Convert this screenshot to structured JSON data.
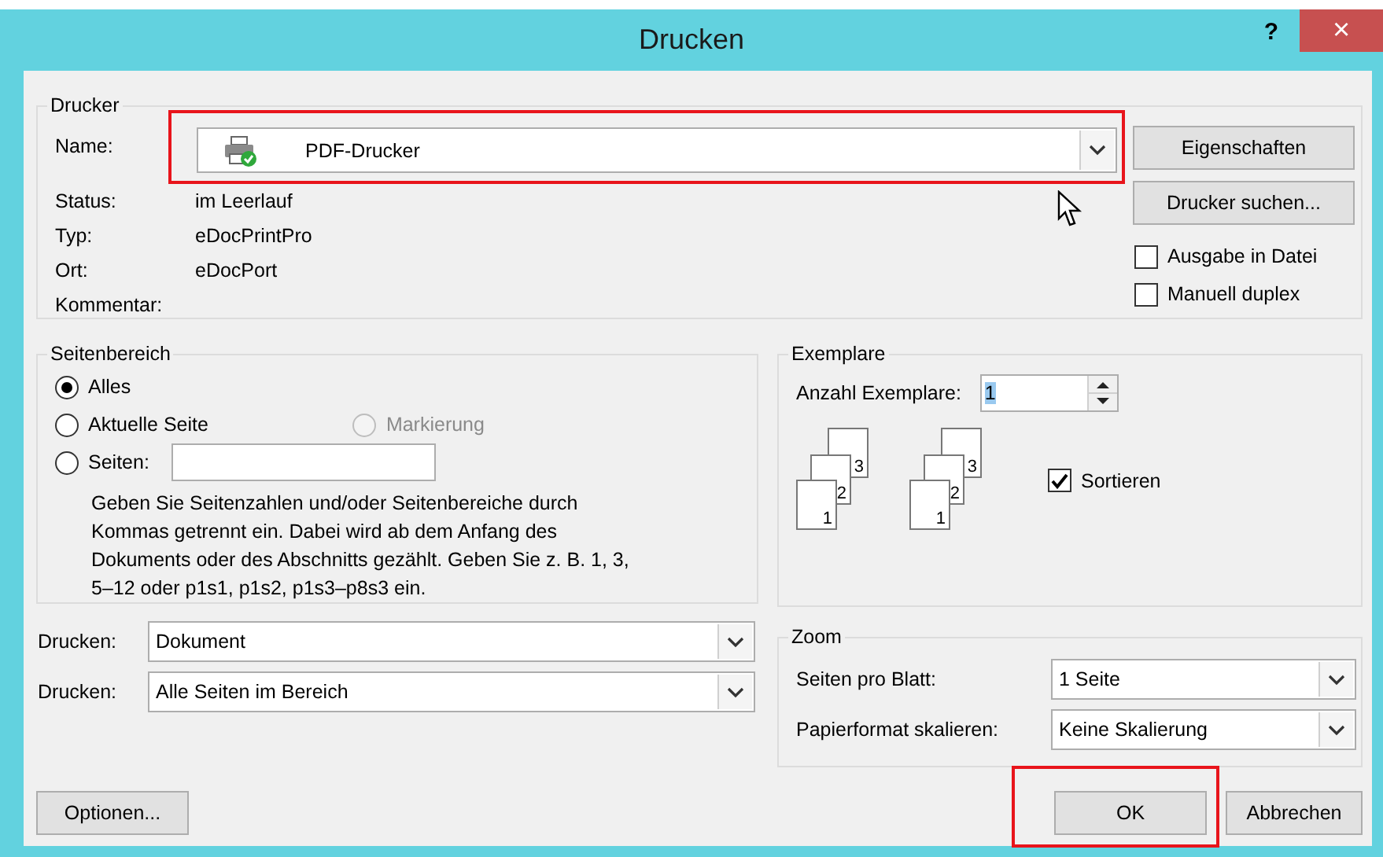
{
  "window": {
    "title": "Drucken",
    "help": "?",
    "close": "×"
  },
  "printer": {
    "title": "Drucker",
    "name_label": "Name:",
    "name_value": "PDF-Drucker",
    "highlighted": true,
    "fields": [
      {
        "label": "Status:",
        "value": "im Leerlauf"
      },
      {
        "label": "Typ:",
        "value": "eDocPrintPro"
      },
      {
        "label": "Ort:",
        "value": "eDocPort"
      },
      {
        "label": "Kommentar:"
      }
    ],
    "buttons": [
      "Eigenschaften",
      "Drucker suchen..."
    ],
    "options": [
      {
        "label": "Ausgabe in Datei",
        "checked": false
      },
      {
        "label": "Manuell duplex",
        "checked": false
      }
    ]
  },
  "page_range": {
    "title": "Seitenbereich",
    "rows": [
      [
        {
          "kind": "radio",
          "label": "Alles",
          "selected": true,
          "disabled": false
        }
      ],
      [
        {
          "kind": "radio",
          "label": "Aktuelle Seite",
          "selected": false,
          "disabled": false
        },
        {
          "kind": "radio",
          "label": "Markierung",
          "selected": false,
          "disabled": true
        }
      ],
      [
        {
          "kind": "radio_field",
          "label": "Seiten:",
          "selected": false,
          "disabled": false
        }
      ]
    ],
    "hint": "Geben Sie Seitenzahlen und/oder Seitenbereiche durch Kommas getrennt ein. Dabei wird ab dem Anfang des Dokuments oder des Abschnitts gezählt. Geben Sie z. B. 1, 3, 5–12 oder p1s1, p1s2, p1s3–p8s3 ein."
  },
  "print_what": [
    {
      "label": "Drucken:",
      "value": "Dokument"
    },
    {
      "label": "Drucken:",
      "value": "Alle Seiten im Bereich"
    }
  ],
  "copies": {
    "title": "Exemplare",
    "label": "Anzahl Exemplare:",
    "value": "1",
    "value_selected": true,
    "stacks": [
      [
        "3",
        "2",
        "1"
      ],
      [
        "3",
        "2",
        "1"
      ]
    ],
    "collate": {
      "label": "Sortieren",
      "checked": true
    }
  },
  "zoom": {
    "title": "Zoom",
    "rows": [
      {
        "label": "Seiten pro Blatt:",
        "value": "1 Seite"
      },
      {
        "label": "Papierformat skalieren:",
        "value": "Keine Skalierung"
      }
    ]
  },
  "footer": [
    {
      "kind": "left",
      "label": "Optionen...",
      "highlighted": false
    },
    {
      "kind": "right",
      "label": "OK",
      "highlighted": true
    },
    {
      "kind": "right",
      "label": "Abbrechen",
      "highlighted": false
    }
  ]
}
